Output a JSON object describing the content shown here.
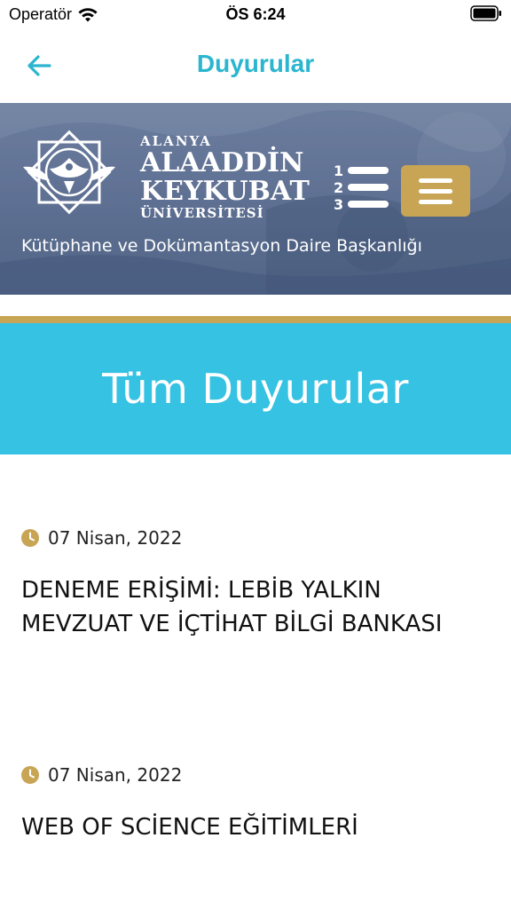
{
  "status_bar": {
    "carrier": "Operatör",
    "time": "ÖS 6:24",
    "icons": [
      "wifi-icon",
      "battery-icon"
    ]
  },
  "nav": {
    "title": "Duyurular",
    "back_icon": "arrow-left-icon"
  },
  "banner": {
    "logo_line1": "ALANYA",
    "logo_line2": "ALAADDİN",
    "logo_line3": "KEYKUBAT",
    "logo_line4": "ÜNİVERSİTESİ",
    "department": "Kütüphane ve Dokümantasyon Daire Başkanlığı",
    "list_icon": "numbered-list-icon",
    "menu_icon": "hamburger-menu-icon"
  },
  "section": {
    "title": "Tüm Duyurular"
  },
  "announcements": [
    {
      "date": "07 Nisan, 2022",
      "title": "DENEME ERİŞİMİ: LEBİB YALKIN MEVZUAT VE İÇTİHAT BİLGİ BANKASI"
    },
    {
      "date": "07 Nisan, 2022",
      "title": "WEB OF SCİENCE EĞİTİMLERİ"
    }
  ],
  "colors": {
    "accent": "#2bb5cf",
    "section_bg": "#36c2e3",
    "gold": "#c8a555",
    "banner_bg": "#5f7192"
  }
}
